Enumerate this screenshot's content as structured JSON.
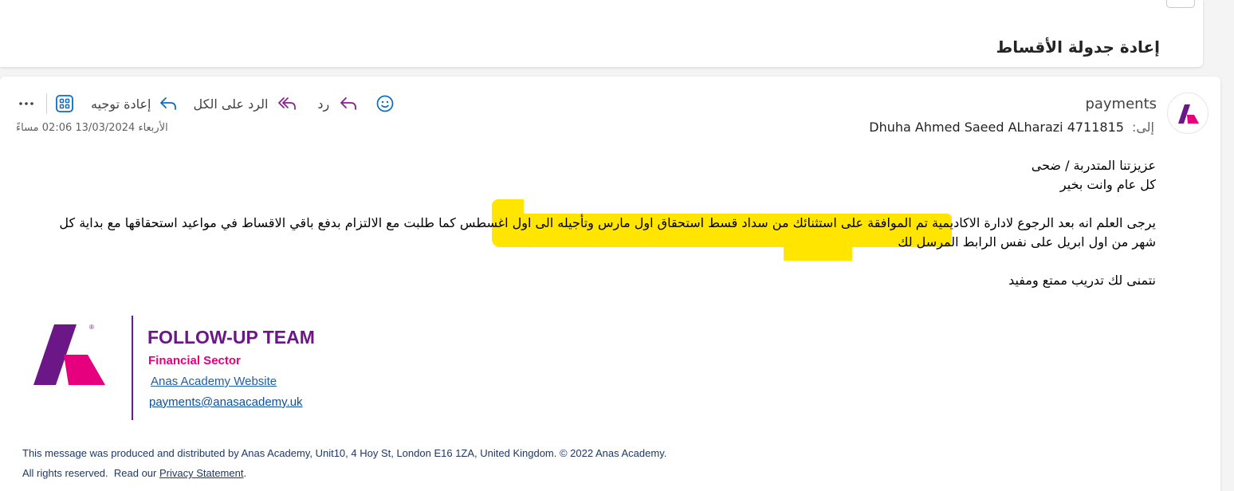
{
  "subject": "إعادة جدولة الأقساط",
  "message": {
    "sender": "payments",
    "to_label": "إلى:",
    "to_value": "Dhuha Ahmed Saeed ALharazi 4711815",
    "date": "الأربعاء 13/03/2024 02:06 مساءً",
    "toolbar": {
      "reply_label": "رد",
      "reply_all_label": "الرد على الكل",
      "forward_label": "إعادة توجيه",
      "icons": [
        "emoji-icon",
        "reply-icon",
        "reply-all-icon",
        "forward-icon",
        "apps-icon",
        "more-icon"
      ]
    }
  },
  "body": {
    "greeting": "عزيزتنا المتدربة / ضحى",
    "wishes": "كل عام وانت بخير",
    "para_start": "يرجى العلم انه بعد الرجوع لادارة الاكاديمية ",
    "para_highlight": "تم الموافقة على استثنائك من سداد قسط استحقاق اول مارس وتأجيله الى اول اغسطس",
    "para_end": " كما طلبت مع الالتزام بدفع باقي الاقساط في مواعيد استحقاقها مع بداية كل شهر من اول ابريل على نفس الرابط المرسل لك",
    "closing": "نتمنى لك تدريب ممتع ومفيد",
    "highlight_color": "#ffe500"
  },
  "signature": {
    "team": "FOLLOW-UP TEAM",
    "sector": "Financial Sector",
    "website_link": "Anas Academy Website",
    "email_link": "payments@anasacademy.uk",
    "brand_purple": "#6c1787",
    "brand_pink": "#e6007e",
    "logo_mark": "®"
  },
  "footer": {
    "line1": "This message was produced and distributed by Anas Academy, Unit10, 4 Hoy St, London E16 1ZA, United Kingdom. © 2022 Anas Academy.",
    "line2_prefix": "All rights reserved.  Read our ",
    "privacy_link": "Privacy Statement",
    "line2_suffix": "."
  }
}
